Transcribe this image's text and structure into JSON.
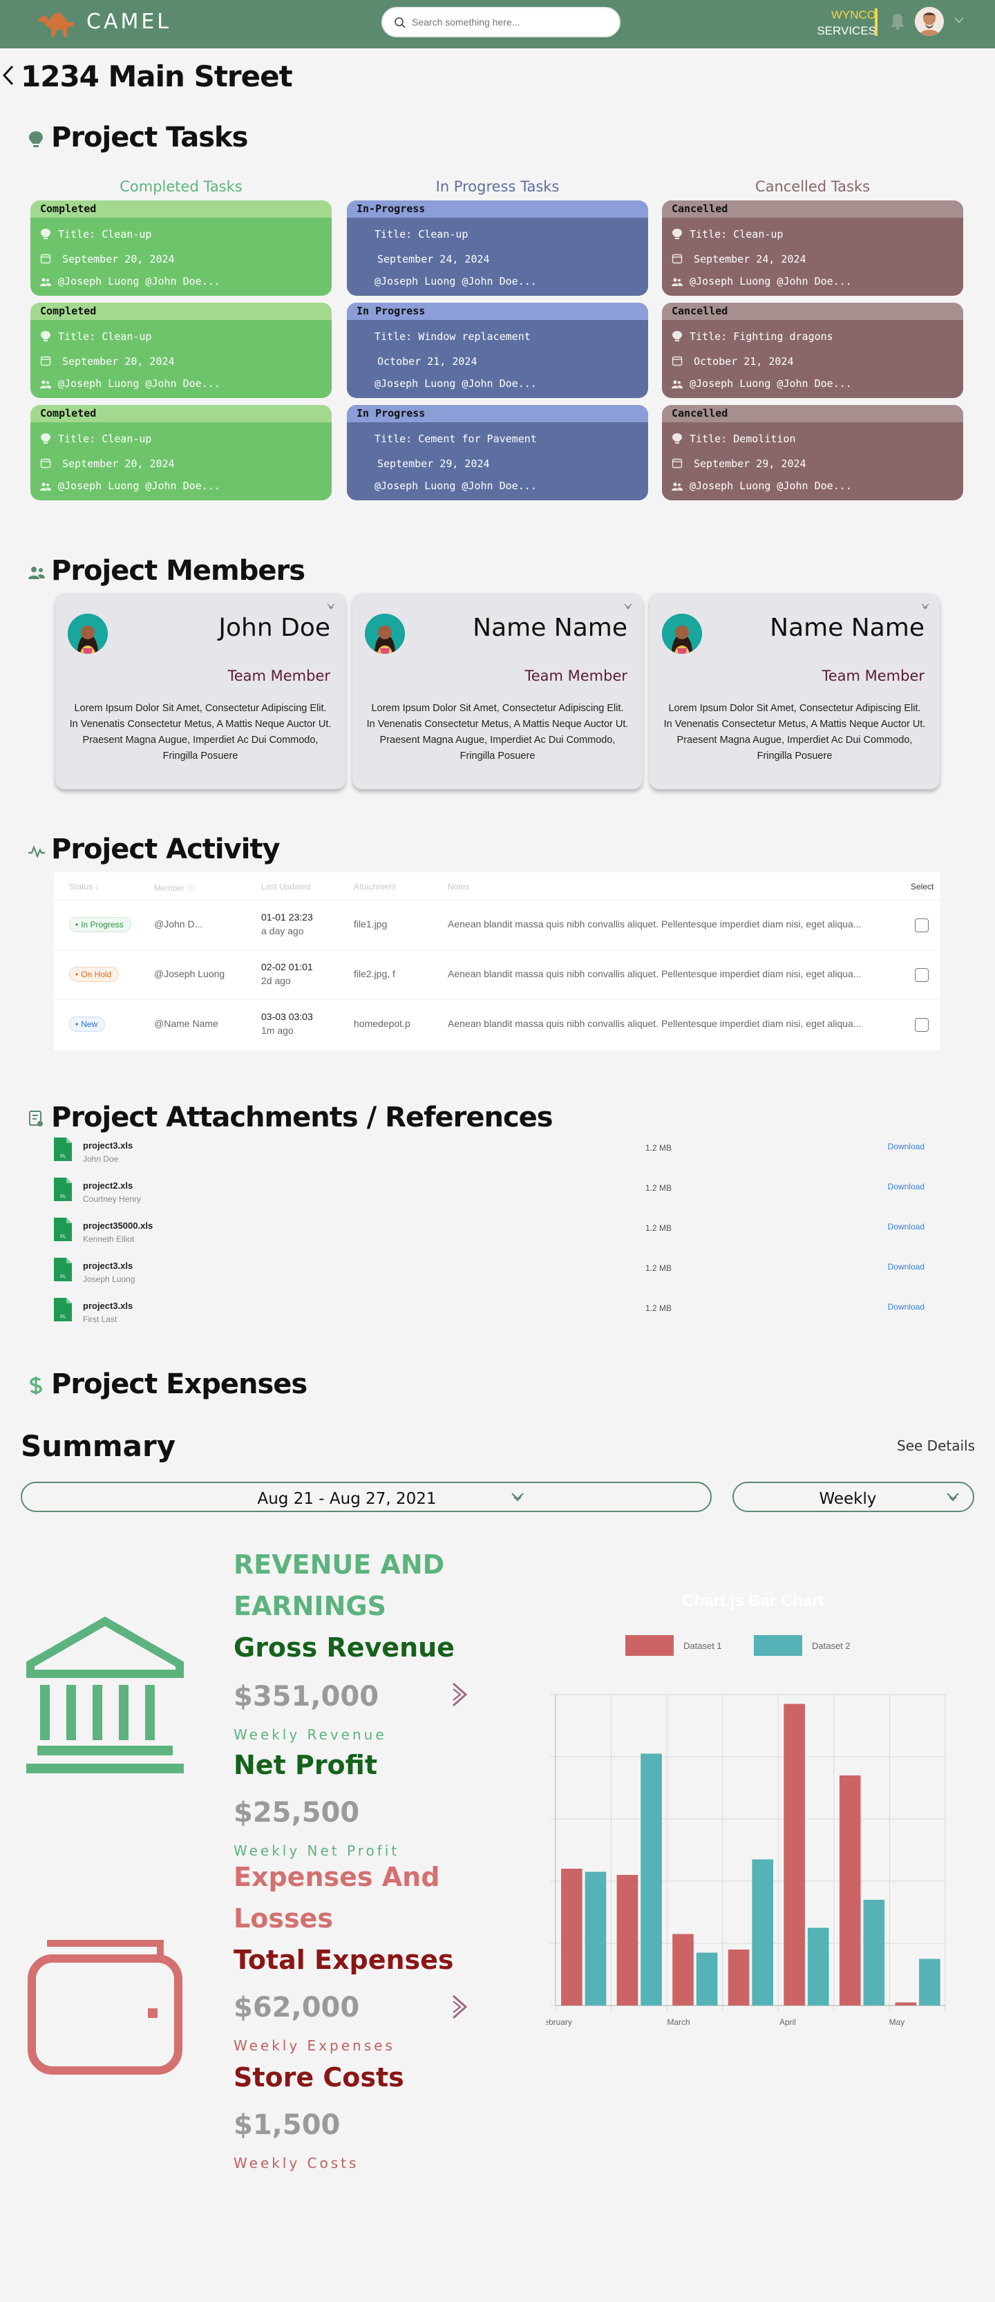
{
  "header": {
    "brand": "CAMEL",
    "search_placeholder": "Search something here...",
    "company_line1": "WYNCO",
    "company_line2": "SERVICES"
  },
  "page_title": "1234 Main Street",
  "sections": {
    "tasks": "Project Tasks",
    "members": "Project Members",
    "activity": "Project Activity",
    "attachments": "Project Attachments / References",
    "expenses": "Project Expenses"
  },
  "tasks": {
    "columns": [
      "Completed Tasks",
      "In Progress Tasks",
      "Cancelled Tasks"
    ],
    "completed": [
      {
        "status": "Completed",
        "title": "Title: Clean-up",
        "date": "September 20, 2024",
        "people": "@Joseph Luong @John Doe..."
      },
      {
        "status": "Completed",
        "title": "Title: Clean-up",
        "date": "September 20, 2024",
        "people": "@Joseph Luong @John Doe..."
      },
      {
        "status": "Completed",
        "title": "Title: Clean-up",
        "date": "September 20, 2024",
        "people": "@Joseph Luong @John Doe..."
      }
    ],
    "in_progress": [
      {
        "status": "In-Progress",
        "title": "Title: Clean-up",
        "date": "September 24, 2024",
        "people": "@Joseph Luong @John Doe..."
      },
      {
        "status": "In Progress",
        "title": "Title: Window replacement",
        "date": "October 21, 2024",
        "people": "@Joseph Luong @John Doe..."
      },
      {
        "status": "In Progress",
        "title": "Title: Cement for Pavement",
        "date": "September 29, 2024",
        "people": "@Joseph Luong @John Doe..."
      }
    ],
    "cancelled": [
      {
        "status": "Cancelled",
        "title": "Title: Clean-up",
        "date": "September 24, 2024",
        "people": "@Joseph Luong @John Doe..."
      },
      {
        "status": "Cancelled",
        "title": "Title: Fighting dragons",
        "date": "October 21, 2024",
        "people": "@Joseph Luong @John Doe..."
      },
      {
        "status": "Cancelled",
        "title": "Title: Demolition",
        "date": "September 29, 2024",
        "people": "@Joseph Luong @John Doe..."
      }
    ]
  },
  "members": [
    {
      "name": "John Doe",
      "role": "Team Member",
      "bio": "Lorem Ipsum Dolor Sit Amet, Consectetur Adipiscing Elit. In Venenatis Consectetur Metus, A Mattis Neque Auctor Ut. Praesent Magna Augue, Imperdiet Ac Dui Commodo, Fringilla Posuere"
    },
    {
      "name": "Name Name",
      "role": "Team Member",
      "bio": "Lorem Ipsum Dolor Sit Amet, Consectetur Adipiscing Elit. In Venenatis Consectetur Metus, A Mattis Neque Auctor Ut. Praesent Magna Augue, Imperdiet Ac Dui Commodo, Fringilla Posuere"
    },
    {
      "name": "Name Name",
      "role": "Team Member",
      "bio": "Lorem Ipsum Dolor Sit Amet, Consectetur Adipiscing Elit. In Venenatis Consectetur Metus, A Mattis Neque Auctor Ut. Praesent Magna Augue, Imperdiet Ac Dui Commodo, Fringilla Posuere"
    }
  ],
  "activity": {
    "headers": {
      "status": "Status",
      "member": "Member",
      "updated": "Last Updated",
      "attachment": "Attachment",
      "notes": "Notes",
      "select": "Select"
    },
    "rows": [
      {
        "status": "In Progress",
        "member": "@John D...",
        "date": "01-01 23:23",
        "ago": "a day ago",
        "file": "file1.jpg",
        "notes": "Aenean blandit massa quis nibh convallis aliquet. Pellentesque imperdiet diam nisi, eget aliqua..."
      },
      {
        "status": "On Hold",
        "member": "@Joseph Luong",
        "date": "02-02 01:01",
        "ago": "2d ago",
        "file": "file2.jpg, f",
        "notes": "Aenean blandit massa quis nibh convallis aliquet. Pellentesque imperdiet diam nisi, eget aliqua..."
      },
      {
        "status": "New",
        "member": "@Name Name",
        "date": "03-03 03:03",
        "ago": "1m ago",
        "file": "homedepot.p",
        "notes": "Aenean blandit massa quis nibh convallis aliquet. Pellentesque imperdiet diam nisi, eget aliqua..."
      }
    ]
  },
  "attachments": [
    {
      "name": "project3.xls",
      "user": "John Doe",
      "size": "1.2 MB",
      "action": "Download"
    },
    {
      "name": "project2.xls",
      "user": "Courtney Henry",
      "size": "1.2 MB",
      "action": "Download"
    },
    {
      "name": "project35000.xls",
      "user": "Kenneth Elliot",
      "size": "1.2 MB",
      "action": "Download"
    },
    {
      "name": "project3.xls",
      "user": "Joseph Luong",
      "size": "1.2 MB",
      "action": "Download"
    },
    {
      "name": "project3.xls",
      "user": "First Last",
      "size": "1.2 MB",
      "action": "Download"
    }
  ],
  "file_badge": "XL",
  "expenses": {
    "summary": "Summary",
    "see_details": "See Details",
    "date_range": "Aug 21 - Aug 27, 2021",
    "period": "Weekly",
    "revenue": {
      "heading1": "REVENUE AND",
      "heading2": "EARNINGS",
      "gross_label": "Gross Revenue",
      "gross_value": "$351,000",
      "gross_caption": "Weekly Revenue",
      "net_label": "Net Profit",
      "net_value": "$25,500",
      "net_caption": "Weekly Net Profit"
    },
    "expenses": {
      "heading1": "Expenses And",
      "heading2": "Losses",
      "total_label": "Total Expenses",
      "total_value": "$62,000",
      "total_caption": "Weekly Expenses",
      "store_label": "Store Costs",
      "store_value": "$1,500",
      "store_caption": "Weekly Costs"
    }
  },
  "colors": {
    "header": "#5b8a6f",
    "completed": "#6ec46b",
    "in_progress": "#5d6fa0",
    "cancelled": "#896769",
    "dataset1": "#cc6466",
    "dataset2": "#55b2b6"
  },
  "chart_data": {
    "type": "bar",
    "title": "Chart.js Bar Chart",
    "x_tick_labels": [
      "February",
      "March",
      "April",
      "May"
    ],
    "legend_position": "top",
    "grid": true,
    "series": [
      {
        "name": "Dataset 1",
        "values": [
          44,
          42,
          23,
          18,
          97,
          74,
          1
        ]
      },
      {
        "name": "Dataset 2",
        "values": [
          43,
          81,
          17,
          47,
          25,
          34,
          15
        ]
      }
    ],
    "ylim": [
      0,
      100
    ]
  }
}
